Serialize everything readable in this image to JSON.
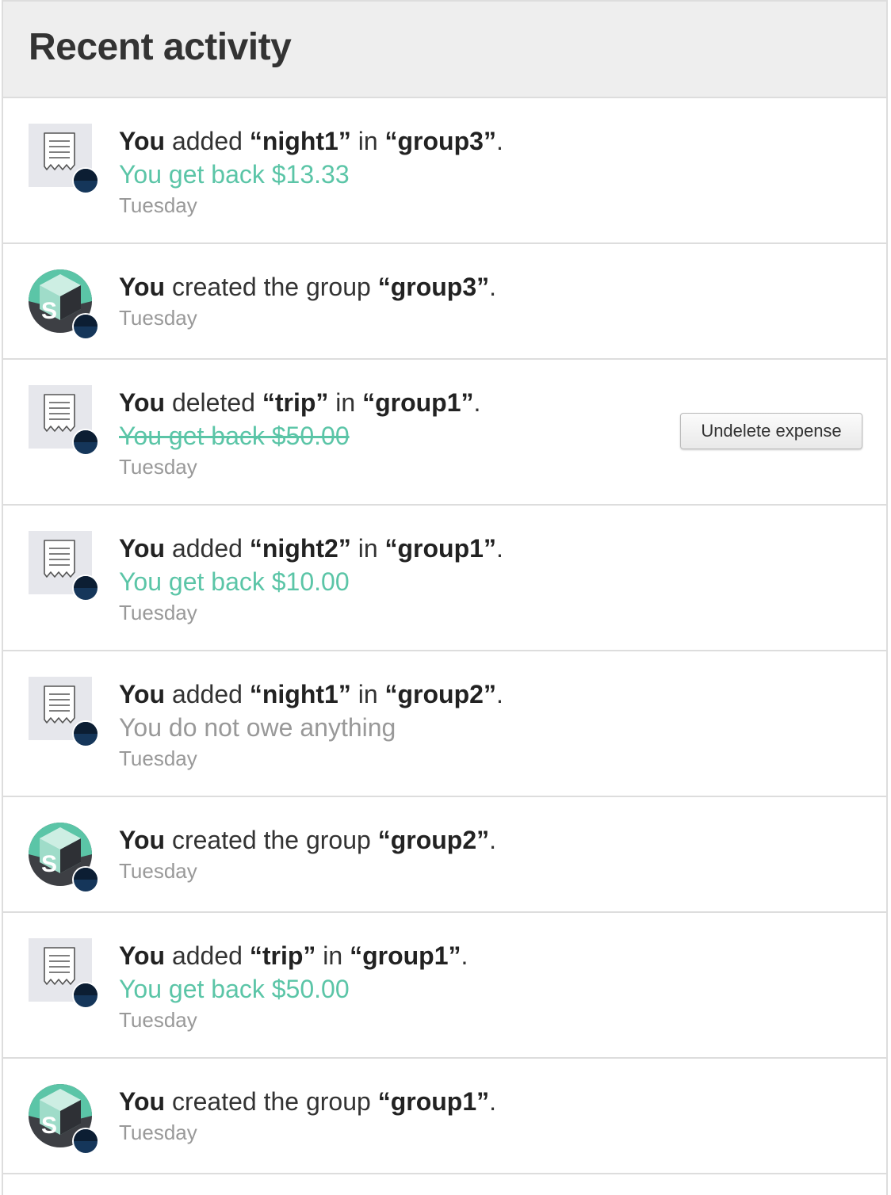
{
  "header": {
    "title": "Recent activity"
  },
  "colors": {
    "positive": "#5bc5a7",
    "neutral": "#999999",
    "text": "#333333",
    "border": "#dddddd",
    "header_bg": "#eeeeee"
  },
  "activities": [
    {
      "icon": "receipt-icon",
      "actor": "You",
      "verb": "added",
      "item": "“night1”",
      "prep": "in",
      "group": "“group3”",
      "end": ".",
      "amount": "You get back $13.33",
      "amount_style": "positive",
      "date": "Tuesday"
    },
    {
      "icon": "group-avatar-icon",
      "actor": "You",
      "verb": "created the group",
      "group": "“group3”",
      "end": ".",
      "date": "Tuesday"
    },
    {
      "icon": "receipt-icon",
      "actor": "You",
      "verb": "deleted",
      "item": "“trip”",
      "prep": "in",
      "group": "“group1”",
      "end": ".",
      "amount": "You get back $50.00",
      "amount_style": "strikethrough",
      "date": "Tuesday",
      "action_label": "Undelete expense"
    },
    {
      "icon": "receipt-icon",
      "actor": "You",
      "verb": "added",
      "item": "“night2”",
      "prep": "in",
      "group": "“group1”",
      "end": ".",
      "amount": "You get back $10.00",
      "amount_style": "positive",
      "date": "Tuesday"
    },
    {
      "icon": "receipt-icon",
      "actor": "You",
      "verb": "added",
      "item": "“night1”",
      "prep": "in",
      "group": "“group2”",
      "end": ".",
      "amount": "You do not owe anything",
      "amount_style": "neutral",
      "date": "Tuesday"
    },
    {
      "icon": "group-avatar-icon",
      "actor": "You",
      "verb": "created the group",
      "group": "“group2”",
      "end": ".",
      "date": "Tuesday"
    },
    {
      "icon": "receipt-icon",
      "actor": "You",
      "verb": "added",
      "item": "“trip”",
      "prep": "in",
      "group": "“group1”",
      "end": ".",
      "amount": "You get back $50.00",
      "amount_style": "positive",
      "date": "Tuesday"
    },
    {
      "icon": "group-avatar-icon",
      "actor": "You",
      "verb": "created the group",
      "group": "“group1”",
      "end": ".",
      "date": "Tuesday"
    }
  ]
}
